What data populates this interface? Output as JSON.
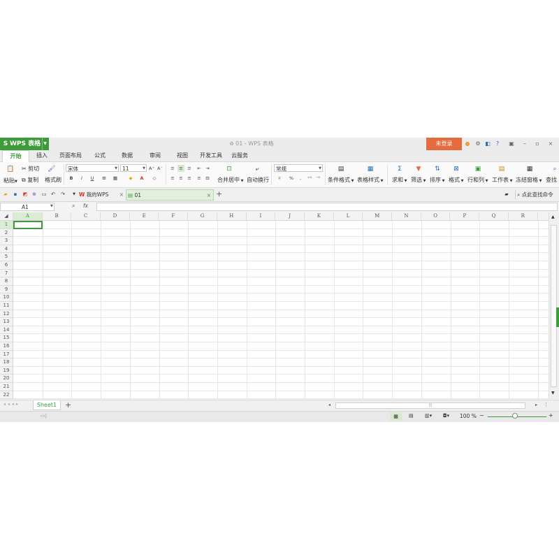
{
  "app": {
    "logo_glyph": "S",
    "name": "WPS 表格",
    "window_title": "01 - WPS 表格",
    "login_label": "未登录",
    "minimize": "–",
    "maximize": "▫",
    "close": "×"
  },
  "tabs": [
    "开始",
    "插入",
    "页面布局",
    "公式",
    "数据",
    "审阅",
    "视图",
    "开发工具",
    "云服务"
  ],
  "ribbon": {
    "paste": "粘贴",
    "cut": "剪切",
    "copy": "复制",
    "format_painter": "格式刷",
    "font_name": "宋体",
    "font_size": "11",
    "bold": "B",
    "italic": "I",
    "underline": "U",
    "font_color": "A",
    "grow_font": "A⁺",
    "shrink_font": "A⁻",
    "merge_center": "合并居中",
    "wrap_text": "自动换行",
    "number_format": "常规",
    "currency": "¥",
    "percent": "%",
    "thousands": ",",
    "conditional_format": "条件格式",
    "table_style": "表格样式",
    "sum": "求和",
    "filter": "筛选",
    "sort": "排序",
    "format": "格式",
    "row_col": "行和列",
    "worksheet": "工作表",
    "freeze": "冻结窗格",
    "find": "查找"
  },
  "docbar": {
    "tab_home": "我的WPS",
    "tab_doc": "01",
    "search_placeholder": "点此查找命令",
    "new_tab": "+"
  },
  "formula": {
    "cell_ref": "A1",
    "fx": "fx"
  },
  "grid": {
    "columns": [
      "A",
      "B",
      "C",
      "D",
      "E",
      "F",
      "G",
      "H",
      "I",
      "J",
      "K",
      "L",
      "M",
      "N",
      "O",
      "P",
      "Q",
      "R"
    ],
    "rows": [
      "1",
      "2",
      "3",
      "4",
      "5",
      "6",
      "7",
      "8",
      "9",
      "10",
      "11",
      "12",
      "13",
      "14",
      "15",
      "16",
      "17",
      "18",
      "19",
      "20",
      "21",
      "22"
    ],
    "selected_cell": "A1"
  },
  "sheets": {
    "active": "Sheet1",
    "add": "+"
  },
  "status": {
    "zoom": "100 %",
    "zoom_out": "−",
    "zoom_in": "+"
  },
  "colors": {
    "brand_green": "#3d9b3a",
    "login_orange": "#e66b3e"
  }
}
